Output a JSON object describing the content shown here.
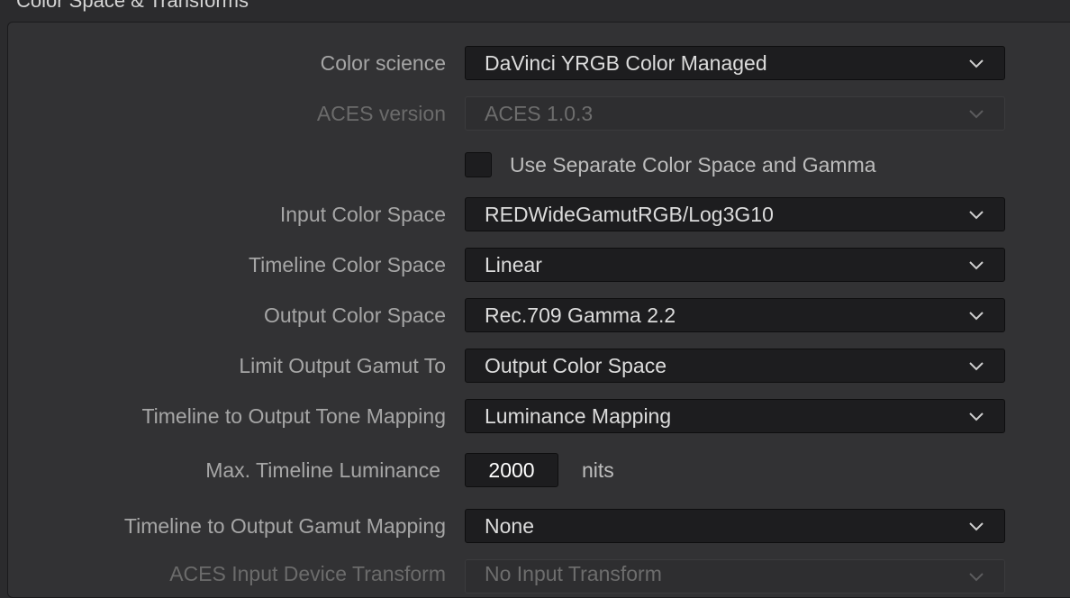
{
  "section": {
    "title": "Color Space & Transforms"
  },
  "fields": {
    "color_science": {
      "label": "Color science",
      "value": "DaVinci YRGB Color Managed"
    },
    "aces_version": {
      "label": "ACES version",
      "value": "ACES 1.0.3"
    },
    "separate_gamma": {
      "label": "Use Separate Color Space and Gamma",
      "checked": false
    },
    "input_color_space": {
      "label": "Input Color Space",
      "value": "REDWideGamutRGB/Log3G10"
    },
    "timeline_color_space": {
      "label": "Timeline Color Space",
      "value": "Linear"
    },
    "output_color_space": {
      "label": "Output Color Space",
      "value": "Rec.709 Gamma 2.2"
    },
    "limit_output_gamut": {
      "label": "Limit Output Gamut To",
      "value": "Output Color Space"
    },
    "tone_mapping": {
      "label": "Timeline to Output Tone Mapping",
      "value": "Luminance Mapping"
    },
    "max_luminance": {
      "label": "Max. Timeline Luminance",
      "value": "2000",
      "unit": "nits"
    },
    "gamut_mapping": {
      "label": "Timeline to Output Gamut Mapping",
      "value": "None"
    },
    "aces_idt": {
      "label": "ACES Input Device Transform",
      "value": "No Input Transform"
    }
  },
  "icons": {
    "dropdown": "chevron-down-icon"
  },
  "colors": {
    "background": "#2b2b2d",
    "panel": "#323234",
    "field": "#1d1d1f",
    "label_text": "#a6a6a6",
    "value_text": "#dcdcdc"
  }
}
